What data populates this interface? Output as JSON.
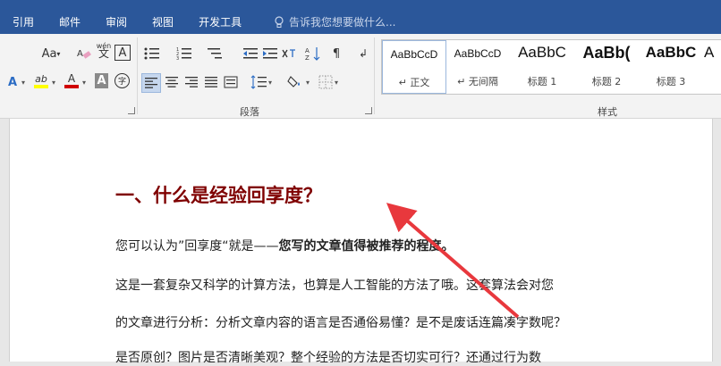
{
  "tabs": [
    "引用",
    "邮件",
    "审阅",
    "视图",
    "开发工具"
  ],
  "tell_me": "告诉我您想要做什么...",
  "ribbon": {
    "paragraph_group_label": "段落",
    "styles_group_label": "样式",
    "icons": {
      "font_size_label": "Aa",
      "phonetic_top": "wén",
      "phonetic_bottom": "文",
      "char_border": "A",
      "text_effect": "A",
      "highlight": "ab",
      "font_color": "A",
      "char_shading": "A",
      "enclose": "字"
    }
  },
  "styles": [
    {
      "sample": "AaBbCcD",
      "name": "↵ 正文",
      "weight": "normal",
      "size": 13
    },
    {
      "sample": "AaBbCcD",
      "name": "↵ 无间隔",
      "weight": "normal",
      "size": 13
    },
    {
      "sample": "AaBbC",
      "name": "标题 1",
      "weight": "normal",
      "size": 18
    },
    {
      "sample": "AaBb(",
      "name": "标题 2",
      "weight": "bold",
      "size": 19
    },
    {
      "sample": "AaBbC",
      "name": "标题 3",
      "weight": "bold",
      "size": 18
    },
    {
      "sample": "A",
      "name": "",
      "weight": "normal",
      "size": 18
    }
  ],
  "document": {
    "title": "一、什么是经验回享度？",
    "line1_prefix": "您可以认为”回享度“就是——",
    "line1_bold": "您写的文章值得被推荐的程度。",
    "line2": "这是一套复杂又科学的计算方法，也算是人工智能的方法了哦。这套算法会对您",
    "line3": "的文章进行分析：分析文章内容的语言是否通俗易懂？是不是废话连篇凑字数呢？",
    "line4": "是否原创？图片是否清晰美观？整个经验的方法是否切实可行？还通过行为数"
  },
  "colors": {
    "titlebar": "#2b579a",
    "heading": "#7f0000",
    "arrow": "#e8383d",
    "highlight_bar": "#ffff00",
    "font_color_bar": "#d00000"
  }
}
